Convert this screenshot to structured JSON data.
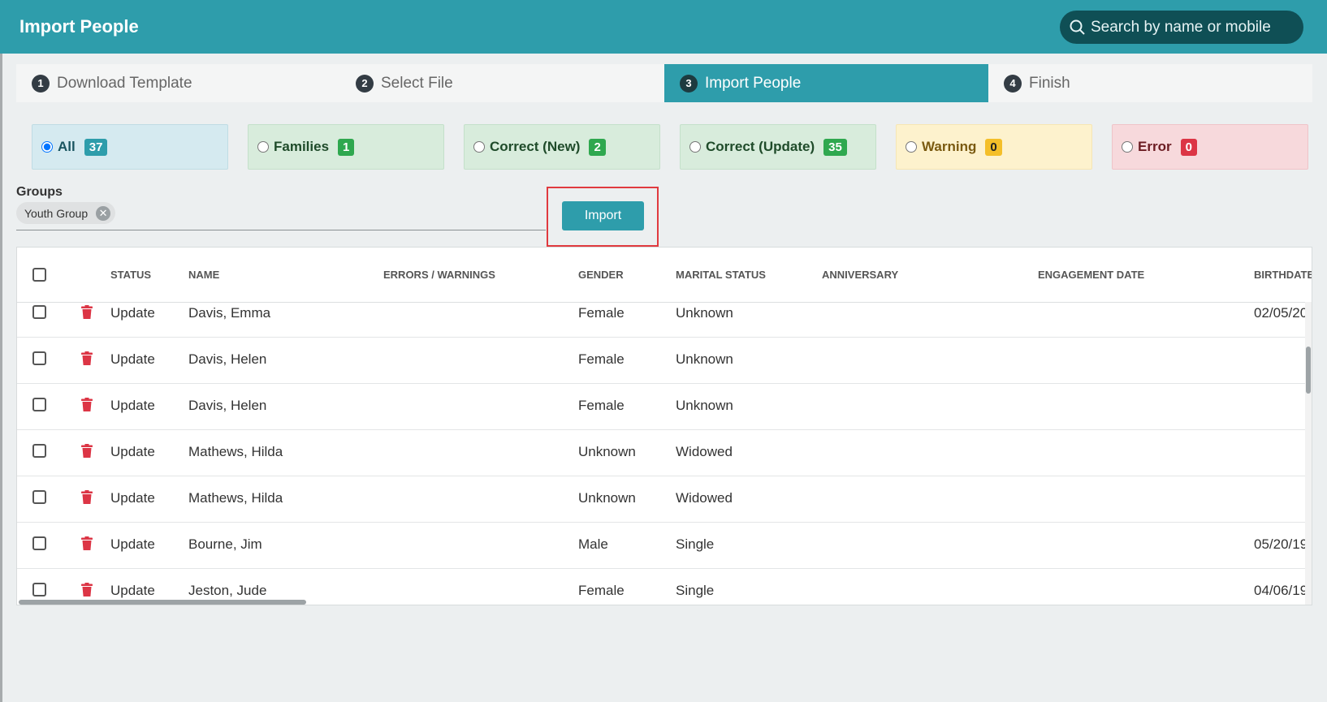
{
  "header": {
    "title": "Import People",
    "search_placeholder": "Search by name or mobile"
  },
  "steps": [
    {
      "num": "1",
      "label": "Download Template"
    },
    {
      "num": "2",
      "label": "Select File"
    },
    {
      "num": "3",
      "label": "Import People",
      "active": true
    },
    {
      "num": "4",
      "label": "Finish"
    }
  ],
  "filters": [
    {
      "label": "All",
      "count": "37",
      "checked": true
    },
    {
      "label": "Families",
      "count": "1"
    },
    {
      "label": "Correct (New)",
      "count": "2"
    },
    {
      "label": "Correct (Update)",
      "count": "35"
    },
    {
      "label": "Warning",
      "count": "0"
    },
    {
      "label": "Error",
      "count": "0"
    }
  ],
  "groups": {
    "label": "Groups",
    "chip": "Youth Group"
  },
  "import_button": "Import",
  "table": {
    "columns": [
      "STATUS",
      "NAME",
      "ERRORS / WARNINGS",
      "GENDER",
      "MARITAL STATUS",
      "ANNIVERSARY",
      "ENGAGEMENT DATE",
      "BIRTHDATE"
    ],
    "rows": [
      {
        "status": "Update",
        "name": "Davis, Emma",
        "errors": "",
        "gender": "Female",
        "marital": "Unknown",
        "anniversary": "",
        "engagement": "",
        "birthdate": "02/05/20"
      },
      {
        "status": "Update",
        "name": "Davis, Helen",
        "errors": "",
        "gender": "Female",
        "marital": "Unknown",
        "anniversary": "",
        "engagement": "",
        "birthdate": ""
      },
      {
        "status": "Update",
        "name": "Davis, Helen",
        "errors": "",
        "gender": "Female",
        "marital": "Unknown",
        "anniversary": "",
        "engagement": "",
        "birthdate": ""
      },
      {
        "status": "Update",
        "name": "Mathews, Hilda",
        "errors": "",
        "gender": "Unknown",
        "marital": "Widowed",
        "anniversary": "",
        "engagement": "",
        "birthdate": ""
      },
      {
        "status": "Update",
        "name": "Mathews, Hilda",
        "errors": "",
        "gender": "Unknown",
        "marital": "Widowed",
        "anniversary": "",
        "engagement": "",
        "birthdate": ""
      },
      {
        "status": "Update",
        "name": "Bourne, Jim",
        "errors": "",
        "gender": "Male",
        "marital": "Single",
        "anniversary": "",
        "engagement": "",
        "birthdate": "05/20/19"
      },
      {
        "status": "Update",
        "name": "Jeston, Jude",
        "errors": "",
        "gender": "Female",
        "marital": "Single",
        "anniversary": "",
        "engagement": "",
        "birthdate": "04/06/19"
      }
    ]
  },
  "colors": {
    "accent": "#2e9dab",
    "danger": "#dc3545",
    "success": "#2fa84f",
    "warning": "#f4bf29"
  }
}
